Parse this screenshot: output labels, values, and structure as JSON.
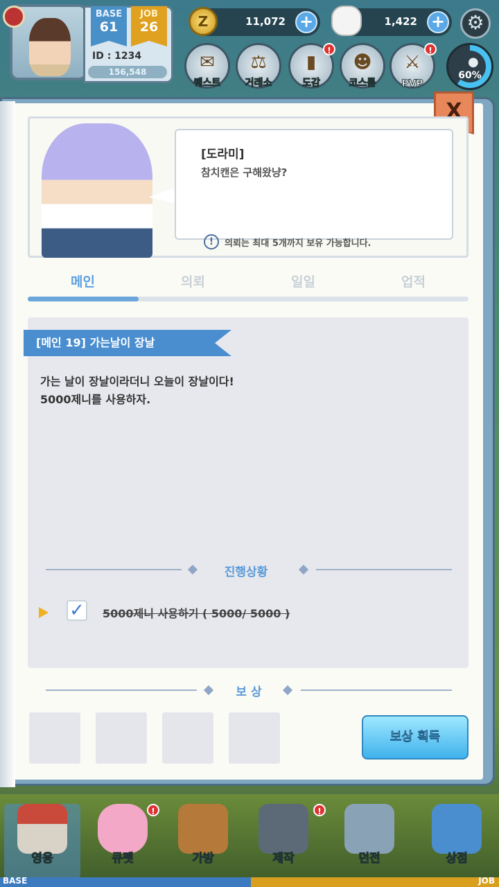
{
  "player": {
    "base_label": "BASE",
    "base_level": "61",
    "job_label": "JOB",
    "job_level": "26",
    "id_text": "ID : 1234",
    "exp": "156,548"
  },
  "currency": {
    "zeny": "11,072",
    "cat": "1,422",
    "zeny_icon_letter": "Z",
    "plus": "+"
  },
  "menu": {
    "items": [
      {
        "label": "퀘스트",
        "icon": "scroll-icon"
      },
      {
        "label": "거래소",
        "icon": "scales-icon"
      },
      {
        "label": "도감",
        "icon": "book-icon",
        "alert": "!"
      },
      {
        "label": "코스튬",
        "icon": "costume-icon"
      },
      {
        "label": "PVP",
        "icon": "shield-swords-icon",
        "alert": "!"
      }
    ],
    "map_percent": "60%"
  },
  "dialog": {
    "close": "X",
    "npc_name": "[도라미]",
    "npc_line": "참치캔은 구해왔냥?",
    "info_icon": "!",
    "info": "의뢰는 최대 5개까지 보유 가능합니다."
  },
  "tabs": [
    "메인",
    "의뢰",
    "일일",
    "업적"
  ],
  "quest": {
    "title": "[메인 19]   가는날이 장날",
    "desc_line1": "가는 날이 장날이라더니 오늘이 장날이다!",
    "desc_line2": "5000제니를 사용하자.",
    "progress_title": "진행상황",
    "objective": "5000제니 사용하기 ( 5000/ 5000 )",
    "check": "✓"
  },
  "reward": {
    "title": "보 상",
    "button": "보상 획득"
  },
  "nav": [
    {
      "label": "영웅",
      "icon": "hero-icon"
    },
    {
      "label": "큐펫",
      "icon": "pet-icon",
      "alert": "!"
    },
    {
      "label": "가방",
      "icon": "bag-icon"
    },
    {
      "label": "제작",
      "icon": "anvil-icon",
      "alert": "!"
    },
    {
      "label": "던전",
      "icon": "dungeon-icon"
    },
    {
      "label": "상점",
      "icon": "shop-icon"
    }
  ],
  "exp_bar": {
    "base": "BASE",
    "job": "JOB"
  },
  "colors": {
    "accent": "#5aa0e0",
    "ribbon": "#4a8ed0",
    "close": "#e8875a"
  }
}
